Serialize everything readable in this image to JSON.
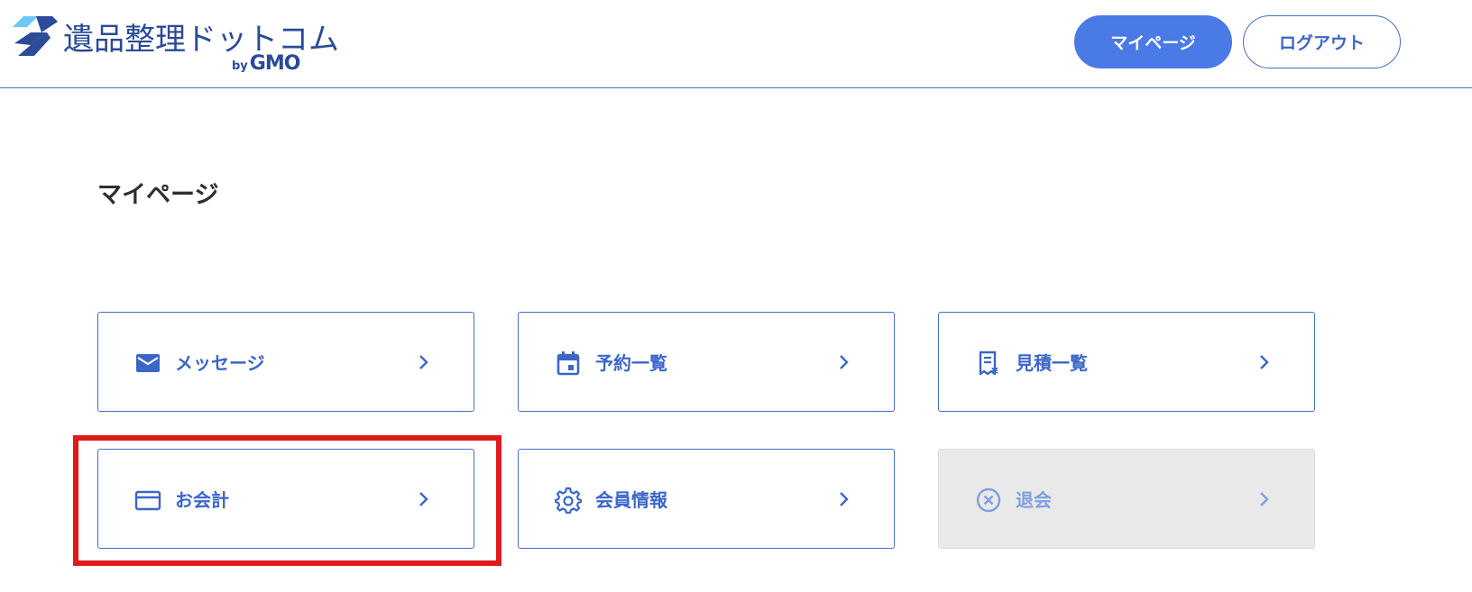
{
  "header": {
    "logo": {
      "text": "遺品整理ドットコム",
      "by": "by",
      "gmo": "GMO"
    },
    "mypage_label": "マイページ",
    "logout_label": "ログアウト"
  },
  "page": {
    "title": "マイページ"
  },
  "menu": [
    {
      "label": "メッセージ",
      "icon": "mail-icon"
    },
    {
      "label": "予約一覧",
      "icon": "calendar-icon"
    },
    {
      "label": "見積一覧",
      "icon": "estimate-icon"
    },
    {
      "label": "お会計",
      "icon": "credit-card-icon"
    },
    {
      "label": "会員情報",
      "icon": "gear-icon"
    },
    {
      "label": "退会",
      "icon": "close-circle-icon",
      "disabled": true
    }
  ],
  "colors": {
    "accent": "#4a7ae6",
    "text_accent": "#3b66c9",
    "border": "#4a6fc4",
    "highlight": "#e0191b",
    "disabled_bg": "#e9e9e9"
  }
}
